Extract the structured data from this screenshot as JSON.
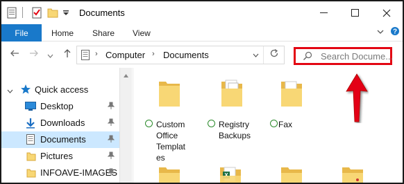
{
  "window": {
    "title": "Documents",
    "minimize": "—",
    "maximize": "☐",
    "close": "✕"
  },
  "ribbon": {
    "file": "File",
    "tabs": [
      "Home",
      "Share",
      "View"
    ],
    "collapse": "⌄",
    "help": "?"
  },
  "address": {
    "crumbs": [
      "Computer",
      "Documents"
    ],
    "separator": "›"
  },
  "search": {
    "placeholder": "Search Docume..."
  },
  "nav_pane": {
    "items": [
      {
        "label": "Quick access",
        "icon": "star-icon",
        "pinned": false
      },
      {
        "label": "Desktop",
        "icon": "desktop-icon",
        "pinned": true
      },
      {
        "label": "Downloads",
        "icon": "download-icon",
        "pinned": true
      },
      {
        "label": "Documents",
        "icon": "documents-icon",
        "pinned": true,
        "selected": true
      },
      {
        "label": "Pictures",
        "icon": "folder-icon",
        "pinned": true
      },
      {
        "label": "INFOAVE-IMAGES",
        "icon": "folder-icon",
        "pinned": true
      }
    ]
  },
  "folders": [
    {
      "lines": [
        "Custom",
        "Office",
        "Templat",
        "es"
      ],
      "synced": true
    },
    {
      "lines": [
        "Registry",
        "Backups"
      ],
      "synced": true
    },
    {
      "lines": [
        "Fax"
      ],
      "synced": true
    }
  ],
  "colors": {
    "accent": "#1979ca",
    "highlight": "#e30613",
    "selection": "#cce8ff",
    "folder": "#f8d775"
  }
}
